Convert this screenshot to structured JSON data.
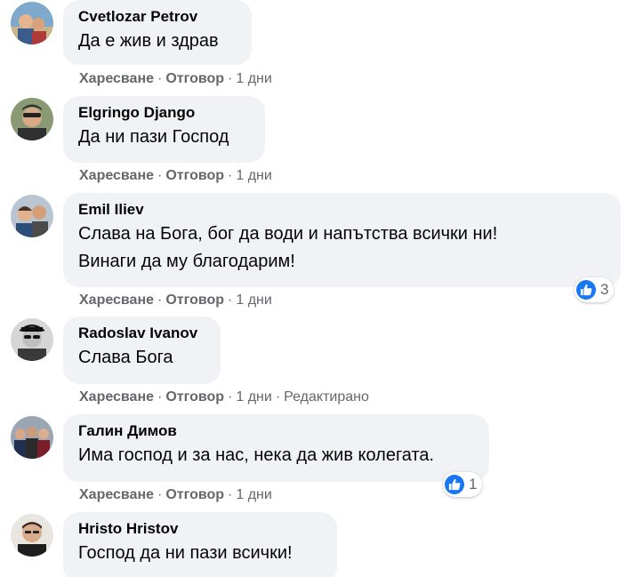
{
  "actions": {
    "like_label": "Харесване",
    "reply_label": "Отговор",
    "separator": "·"
  },
  "colors": {
    "bubble_bg": "#f0f2f5",
    "meta_text": "#65676b",
    "like_blue": "#1877f2"
  },
  "comments": [
    {
      "author": "Cvetlozar Petrov",
      "text_lines": [
        "Да е жив и здрав"
      ],
      "time": "1 дни",
      "edited": "",
      "reactions": null
    },
    {
      "author": "Elgringo Django",
      "text_lines": [
        "Да ни пази Господ"
      ],
      "time": "1 дни",
      "edited": "",
      "reactions": null
    },
    {
      "author": "Emil Iliev",
      "text_lines": [
        "Слава на Бога, бог да води и напътства всички ни!",
        "Винаги да му благодарим!"
      ],
      "time": "1 дни",
      "edited": "",
      "reactions": {
        "icon": "like-icon",
        "count": "3"
      }
    },
    {
      "author": "Radoslav Ivanov",
      "text_lines": [
        "Слава Бога"
      ],
      "time": "1 дни",
      "edited": "Редактирано",
      "reactions": null
    },
    {
      "author": "Галин Димов",
      "text_lines": [
        "Има господ и за нас, нека да жив колегата."
      ],
      "time": "1 дни",
      "edited": "",
      "reactions": {
        "icon": "like-icon",
        "count": "1"
      }
    },
    {
      "author": "Hristo Hristov",
      "text_lines": [
        "Господ да ни пази всички!"
      ],
      "time": "",
      "edited": "",
      "reactions": null
    }
  ]
}
